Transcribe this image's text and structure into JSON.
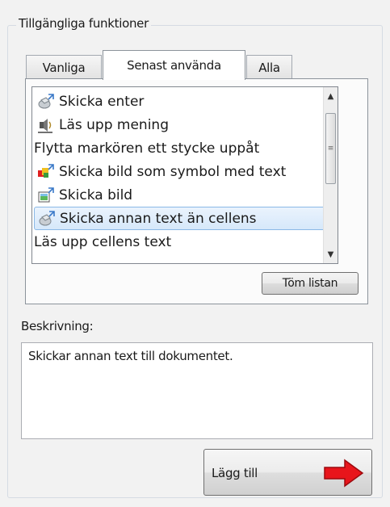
{
  "group_title": "Tillgängliga funktioner",
  "tabs": [
    {
      "label": "Vanliga",
      "active": false
    },
    {
      "label": "Senast använda",
      "active": true
    },
    {
      "label": "Alla",
      "active": false
    }
  ],
  "list": {
    "items": [
      {
        "label": "Skicka enter",
        "icon": "send-enter-icon",
        "selected": false
      },
      {
        "label": "Läs upp mening",
        "icon": "speaker-icon",
        "selected": false
      },
      {
        "label": "Flytta markören ett stycke uppåt",
        "icon": "",
        "selected": false
      },
      {
        "label": "Skicka bild som symbol med text",
        "icon": "symbol-image-icon",
        "selected": false
      },
      {
        "label": "Skicka bild",
        "icon": "send-image-icon",
        "selected": false
      },
      {
        "label": "Skicka annan text än cellens",
        "icon": "send-text-icon",
        "selected": true
      },
      {
        "label": "Läs upp cellens text",
        "icon": "",
        "selected": false
      }
    ]
  },
  "clear_button": "Töm listan",
  "description": {
    "label": "Beskrivning:",
    "text": "Skickar annan text till dokumentet."
  },
  "add_button": {
    "label": "Lägg till",
    "arrow_color": "#e8151b"
  },
  "colors": {
    "selection_bg": "#d6e8fa",
    "selection_border": "#8ab8e6"
  }
}
